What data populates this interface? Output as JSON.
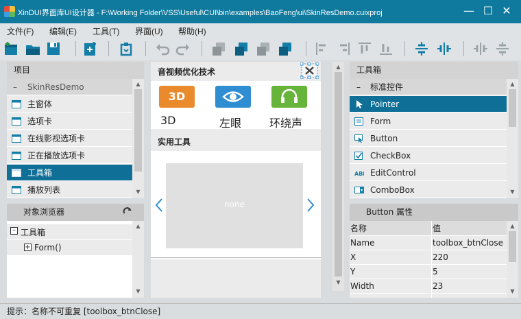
{
  "window": {
    "title": "XinDUI界面库UI设计器 - F:\\Working Folder\\VSS\\Useful\\CUI\\bin\\examples\\BaoFeng\\ui\\SkinResDemo.cuixproj",
    "minimize": "—",
    "maximize": "☐",
    "close": "✕"
  },
  "menu": [
    "文件(F)",
    "编辑(E)",
    "工具(T)",
    "界面(U)",
    "帮助(H)"
  ],
  "project": {
    "header": "项目",
    "group": "SkinResDemo",
    "items": [
      "主窗体",
      "选项卡",
      "在线影视选项卡",
      "正在播放选项卡",
      "工具箱",
      "播放列表"
    ],
    "selected_index": 4
  },
  "browser": {
    "header": "对象浏览器",
    "refresh_icon": "refresh-icon",
    "tree": [
      "工具箱",
      "Form()"
    ]
  },
  "canvas": {
    "section1": "音视频优化技术",
    "tiles": [
      {
        "badge": "3D",
        "label": "3D",
        "color": "#e98a2c"
      },
      {
        "badge": "eye",
        "label": "左眼",
        "color": "#2e8ed1"
      },
      {
        "badge": "headphones",
        "label": "环绕声",
        "color": "#67b43a"
      }
    ],
    "section2": "实用工具",
    "placeholder": "none"
  },
  "toolbox": {
    "header": "工具箱",
    "group": "标准控件",
    "items": [
      "Pointer",
      "Form",
      "Button",
      "CheckBox",
      "EditControl",
      "ComboBox"
    ],
    "selected_index": 0
  },
  "props": {
    "header": "Button 属性",
    "col_name": "名称",
    "col_value": "值",
    "rows": [
      [
        "Name",
        "toolbox_btnClose"
      ],
      [
        "X",
        "220"
      ],
      [
        "Y",
        "5"
      ],
      [
        "Width",
        "23"
      ]
    ]
  },
  "status": "提示：名称不可重复 [toolbox_btnClose]",
  "colors": {
    "accent": "#0f7a9e",
    "selected": "#0f6f97"
  }
}
